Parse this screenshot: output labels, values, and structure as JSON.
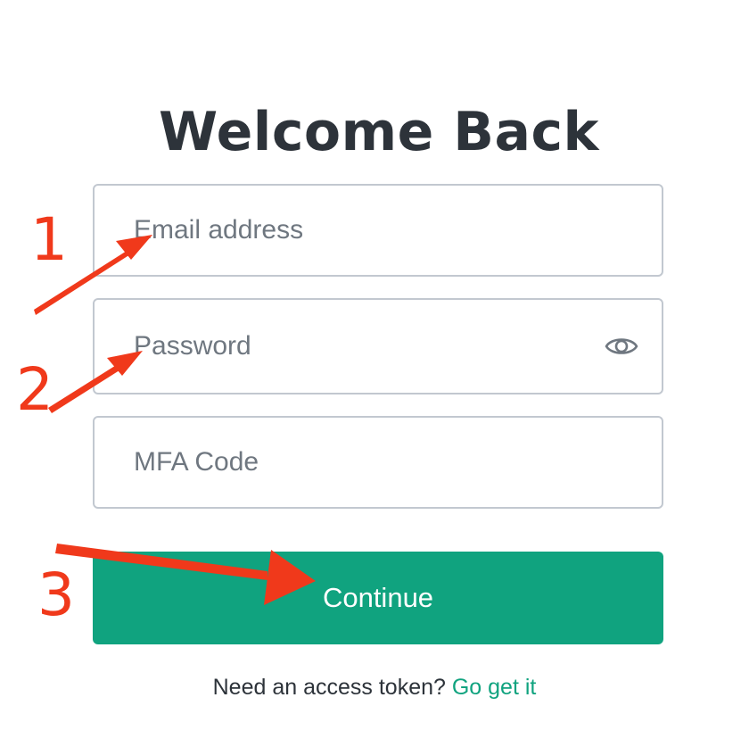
{
  "page": {
    "title": "Welcome Back"
  },
  "form": {
    "email_placeholder": "Email address",
    "password_placeholder": "Password",
    "mfa_placeholder": "MFA Code",
    "show_password_icon": "eye-icon",
    "continue_label": "Continue"
  },
  "footer": {
    "prompt": "Need an access token?",
    "link_label": "Go get it"
  },
  "annotations": {
    "step_labels": [
      "1",
      "2",
      "3"
    ],
    "color": "#f0391b"
  },
  "colors": {
    "accent": "#10a37f",
    "title_text": "#2d333a",
    "field_border": "#c2c8d0",
    "placeholder_text": "#6f7780"
  }
}
